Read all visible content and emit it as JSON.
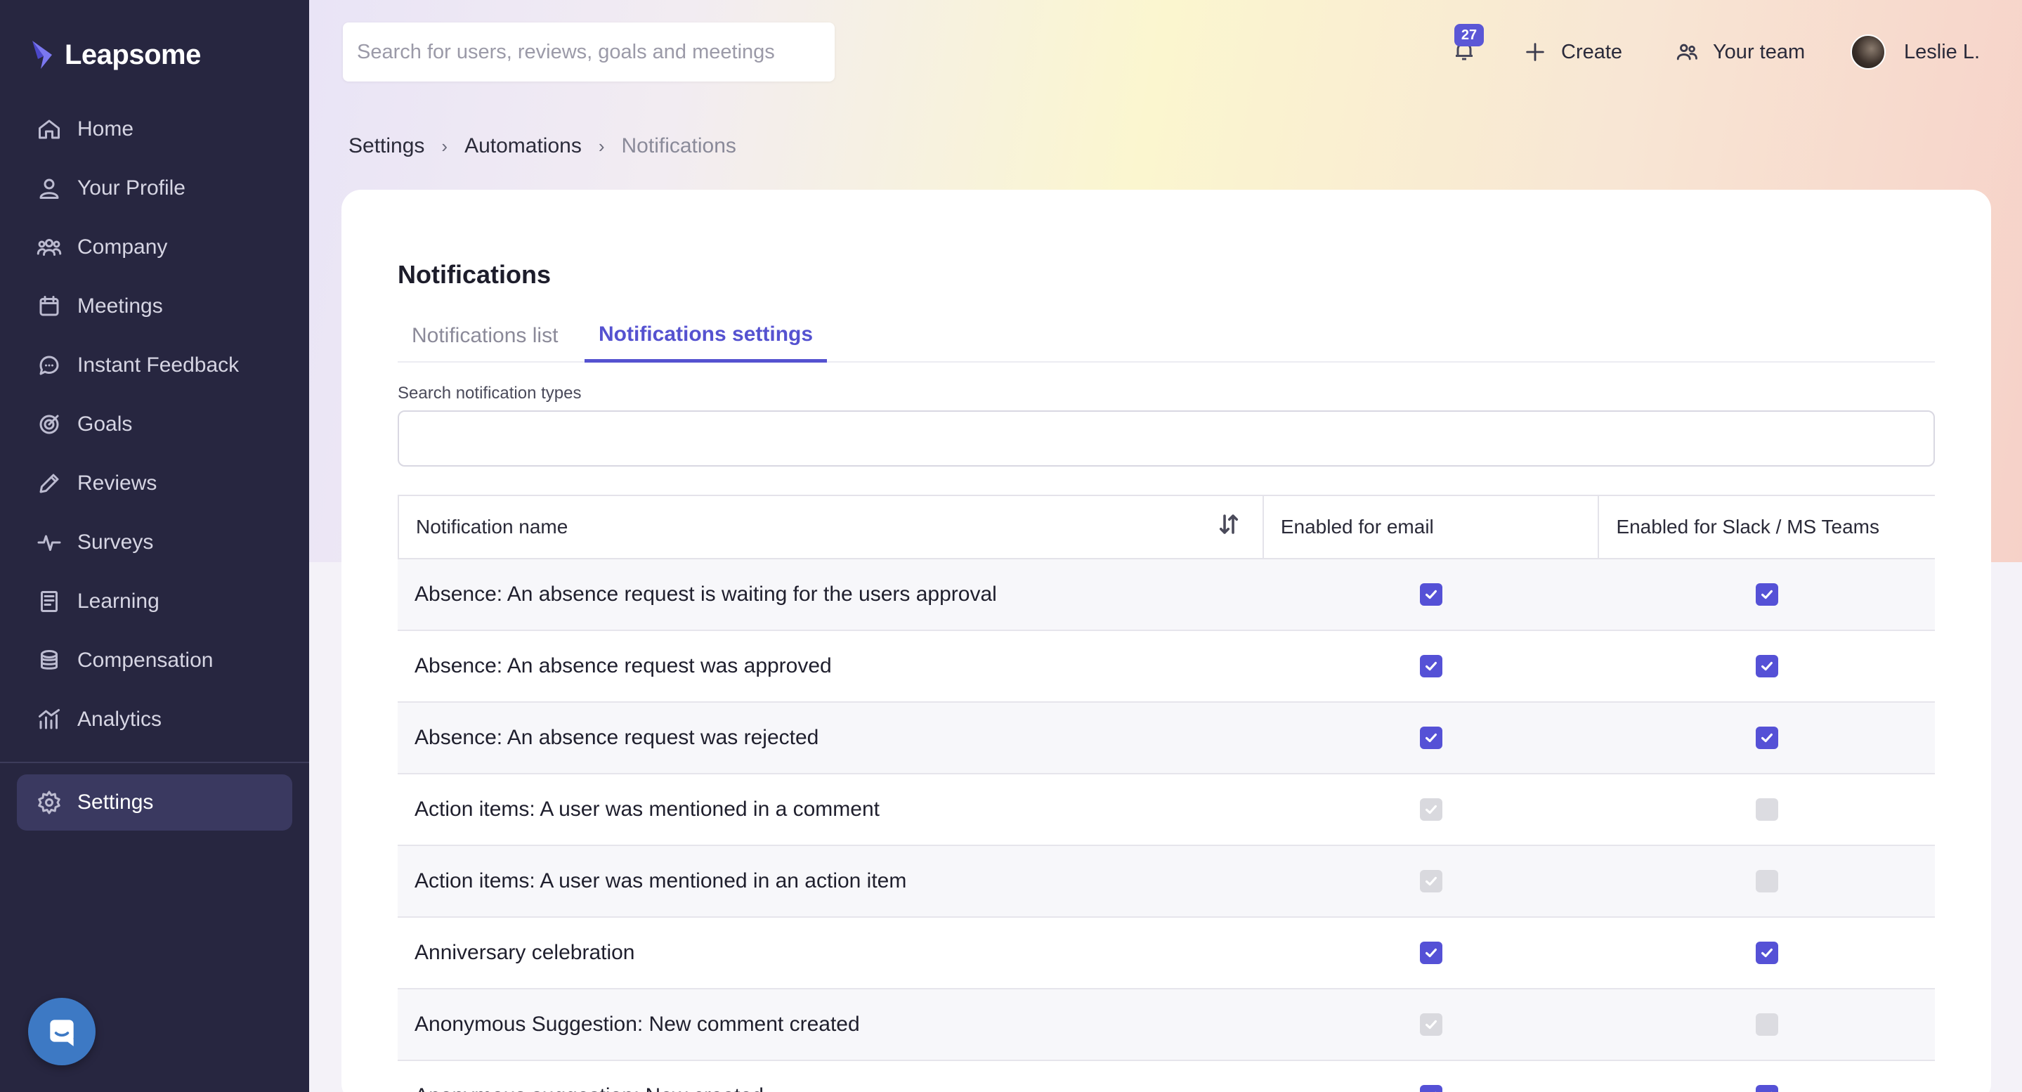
{
  "brand": {
    "name": "Leapsome",
    "accent": "#5551d6",
    "sidebar_bg": "#272640"
  },
  "sidebar": {
    "items": [
      {
        "label": "Home",
        "icon": "home-icon"
      },
      {
        "label": "Your Profile",
        "icon": "user-icon"
      },
      {
        "label": "Company",
        "icon": "users-icon"
      },
      {
        "label": "Meetings",
        "icon": "calendar-icon"
      },
      {
        "label": "Instant Feedback",
        "icon": "chat-icon"
      },
      {
        "label": "Goals",
        "icon": "target-icon"
      },
      {
        "label": "Reviews",
        "icon": "pencil-icon"
      },
      {
        "label": "Surveys",
        "icon": "pulse-icon"
      },
      {
        "label": "Learning",
        "icon": "book-icon"
      },
      {
        "label": "Compensation",
        "icon": "coins-icon"
      },
      {
        "label": "Analytics",
        "icon": "bar-chart-icon"
      }
    ],
    "settings": {
      "label": "Settings",
      "icon": "gear-icon"
    }
  },
  "header": {
    "search_placeholder": "Search for users, reviews, goals and meetings",
    "notification_count": "27",
    "create_label": "Create",
    "team_label": "Your team",
    "user_name": "Leslie L."
  },
  "breadcrumb": {
    "items": [
      "Settings",
      "Automations"
    ],
    "current": "Notifications"
  },
  "page": {
    "title": "Notifications",
    "tabs": [
      {
        "label": "Notifications list",
        "active": false
      },
      {
        "label": "Notifications settings",
        "active": true
      }
    ],
    "search_label": "Search notification types",
    "search_value": ""
  },
  "table": {
    "columns": [
      "Notification name",
      "Enabled for email",
      "Enabled for Slack / MS Teams"
    ],
    "rows": [
      {
        "name": "Absence: An absence request is waiting for the users approval",
        "email": "on",
        "slack": "on"
      },
      {
        "name": "Absence: An absence request was approved",
        "email": "on",
        "slack": "on"
      },
      {
        "name": "Absence: An absence request was rejected",
        "email": "on",
        "slack": "on"
      },
      {
        "name": "Action items: A user was mentioned in a comment",
        "email": "disabled-on",
        "slack": "disabled-off"
      },
      {
        "name": "Action items: A user was mentioned in an action item",
        "email": "disabled-on",
        "slack": "disabled-off"
      },
      {
        "name": "Anniversary celebration",
        "email": "on",
        "slack": "on"
      },
      {
        "name": "Anonymous Suggestion: New comment created",
        "email": "disabled-on",
        "slack": "disabled-off"
      },
      {
        "name": "Anonymous suggestion: New created",
        "email": "on",
        "slack": "on"
      }
    ]
  }
}
